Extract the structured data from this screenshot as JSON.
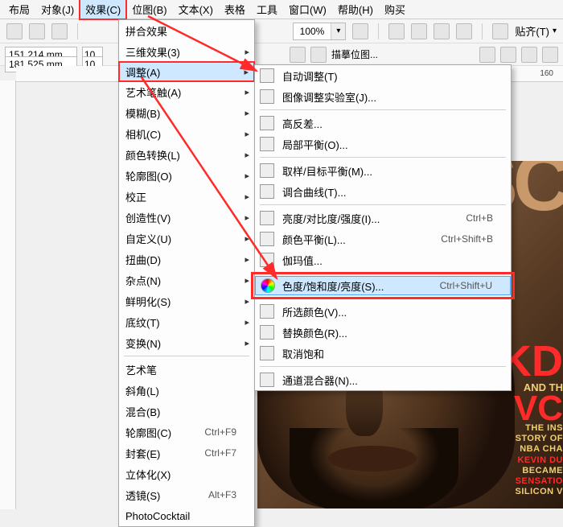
{
  "menubar": {
    "items": [
      {
        "label": "布局"
      },
      {
        "label": "对象(J)"
      },
      {
        "label": "效果(C)"
      },
      {
        "label": "位图(B)"
      },
      {
        "label": "文本(X)"
      },
      {
        "label": "表格"
      },
      {
        "label": "工具"
      },
      {
        "label": "窗口(W)"
      },
      {
        "label": "帮助(H)"
      },
      {
        "label": "购买"
      }
    ]
  },
  "toolbar": {
    "zoom": "100%",
    "align": "贴齐(T)"
  },
  "propbar": {
    "x": "151.214 mm",
    "y": "181.525 mm",
    "count": "10",
    "bitmap_label": "描摹位图..."
  },
  "ruler": {
    "tick160": "160"
  },
  "menu_effects": {
    "items": [
      {
        "label": "拼合效果"
      },
      {
        "label": "三维效果(3)",
        "sub": true
      },
      {
        "label": "调整(A)",
        "sub": true,
        "sel": true
      },
      {
        "label": "艺术笔触(A)",
        "sub": true
      },
      {
        "label": "模糊(B)",
        "sub": true
      },
      {
        "label": "相机(C)",
        "sub": true
      },
      {
        "label": "颜色转换(L)",
        "sub": true
      },
      {
        "label": "轮廓图(O)",
        "sub": true
      },
      {
        "label": "校正",
        "sub": true
      },
      {
        "label": "创造性(V)",
        "sub": true
      },
      {
        "label": "自定义(U)",
        "sub": true
      },
      {
        "label": "扭曲(D)",
        "sub": true
      },
      {
        "label": "杂点(N)",
        "sub": true
      },
      {
        "label": "鲜明化(S)",
        "sub": true
      },
      {
        "label": "底纹(T)",
        "sub": true
      },
      {
        "label": "变换(N)",
        "sub": true
      },
      {
        "sep": true
      },
      {
        "label": "艺术笔"
      },
      {
        "label": "斜角(L)"
      },
      {
        "label": "混合(B)"
      },
      {
        "label": "轮廓图(C)",
        "shortcut": "Ctrl+F9"
      },
      {
        "label": "封套(E)",
        "shortcut": "Ctrl+F7"
      },
      {
        "label": "立体化(X)"
      },
      {
        "label": "透镜(S)",
        "shortcut": "Alt+F3"
      },
      {
        "label": "PhotoCocktail"
      }
    ]
  },
  "menu_adjust": {
    "items": [
      {
        "label": "自动调整(T)"
      },
      {
        "label": "图像调整实验室(J)..."
      },
      {
        "sep": true
      },
      {
        "label": "高反差..."
      },
      {
        "label": "局部平衡(O)..."
      },
      {
        "sep": true
      },
      {
        "label": "取样/目标平衡(M)..."
      },
      {
        "label": "调合曲线(T)..."
      },
      {
        "sep": true
      },
      {
        "label": "亮度/对比度/强度(I)...",
        "shortcut": "Ctrl+B"
      },
      {
        "label": "颜色平衡(L)...",
        "shortcut": "Ctrl+Shift+B"
      },
      {
        "label": "伽玛值..."
      },
      {
        "sep": true
      },
      {
        "label": "色度/饱和度/亮度(S)...",
        "shortcut": "Ctrl+Shift+U",
        "hl": true
      },
      {
        "sep": true
      },
      {
        "label": "所选颜色(V)..."
      },
      {
        "label": "替换颜色(R)..."
      },
      {
        "label": "取消饱和"
      },
      {
        "sep": true
      },
      {
        "label": "通道混合器(N)..."
      }
    ]
  },
  "magazine": {
    "masthead": "SC",
    "kd": "KD",
    "and": "AND TH",
    "vc": "VC",
    "lines": [
      "THE INS",
      "STORY OF",
      "NBA CHA",
      "KEVIN DU",
      "BECAME",
      "SENSATIO",
      "SILICON V"
    ]
  }
}
